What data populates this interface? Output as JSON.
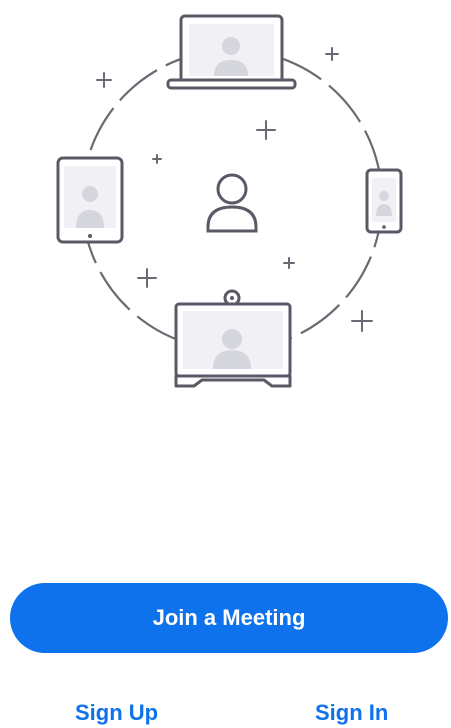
{
  "actions": {
    "join_meeting_label": "Join a Meeting",
    "sign_up_label": "Sign Up",
    "sign_in_label": "Sign In"
  },
  "illustration": {
    "icons": [
      "laptop-icon",
      "tablet-icon",
      "phone-icon",
      "room-system-icon",
      "user-icon"
    ]
  },
  "colors": {
    "accent": "#0e72ed",
    "device_stroke": "#5a5a66",
    "screen_fill": "#f1f1f5",
    "avatar_fill": "#d6d6de"
  }
}
